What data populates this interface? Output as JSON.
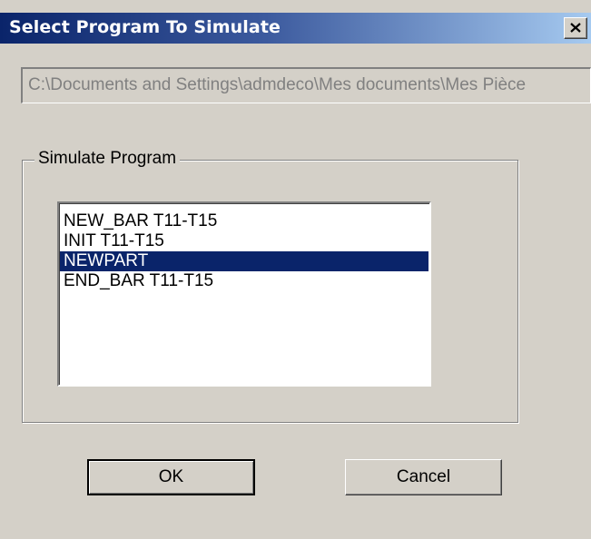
{
  "window": {
    "title": "Select Program To Simulate"
  },
  "path_field": {
    "value": "C:\\Documents and Settings\\admdeco\\Mes documents\\Mes Pièce"
  },
  "group": {
    "label": "Simulate Program"
  },
  "program_list": {
    "items": [
      "NEW_BAR T11-T15",
      "INIT T11-T15",
      "NEWPART",
      "END_BAR T11-T15"
    ],
    "selected": "NEWPART"
  },
  "buttons": {
    "ok_label": "OK",
    "cancel_label": "Cancel"
  },
  "icons": {
    "close": "close-icon"
  },
  "colors": {
    "selection": "#0a246a",
    "face": "#d4d0c8"
  }
}
